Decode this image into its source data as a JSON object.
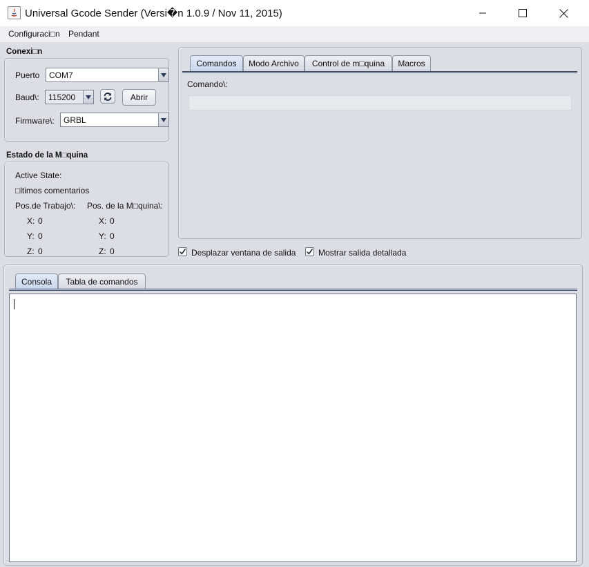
{
  "window": {
    "title": "Universal Gcode Sender (Versi�n 1.0.9 / Nov 11, 2015)"
  },
  "menu": {
    "items": [
      "Configuraci□n",
      "Pendant"
    ]
  },
  "connection": {
    "title": "Conexi□n",
    "port_label": "Puerto",
    "port_value": "COM7",
    "baud_label": "Baud\\:",
    "baud_value": "115200",
    "open_button": "Abrir",
    "firmware_label": "Firmware\\:",
    "firmware_value": "GRBL"
  },
  "machine_state": {
    "title": "Estado de la M□quina",
    "active_state_label": "Active State:",
    "last_comments_label": "□ltimos comentarios",
    "work_pos_label": "Pos.de Trabajo\\:",
    "machine_pos_label": "Pos. de la M□quina\\:",
    "work": [
      {
        "axis": "X:",
        "value": "0"
      },
      {
        "axis": "Y:",
        "value": "0"
      },
      {
        "axis": "Z:",
        "value": "0"
      }
    ],
    "machine": [
      {
        "axis": "X:",
        "value": "0"
      },
      {
        "axis": "Y:",
        "value": "0"
      },
      {
        "axis": "Z:",
        "value": "0"
      }
    ]
  },
  "top_tabs": {
    "items": [
      "Comandos",
      "Modo Archivo",
      "Control de m□quina",
      "Macros"
    ],
    "active": "Comandos"
  },
  "command": {
    "label": "Comando\\:",
    "value": ""
  },
  "options": {
    "scroll_output_label": "Desplazar ventana de salida",
    "scroll_output_checked": true,
    "verbose_output_label": "Mostrar salida detallada",
    "verbose_output_checked": true
  },
  "bottom_tabs": {
    "items": [
      "Consola",
      "Tabla de comandos"
    ],
    "active": "Consola"
  },
  "console": {
    "text": ""
  }
}
